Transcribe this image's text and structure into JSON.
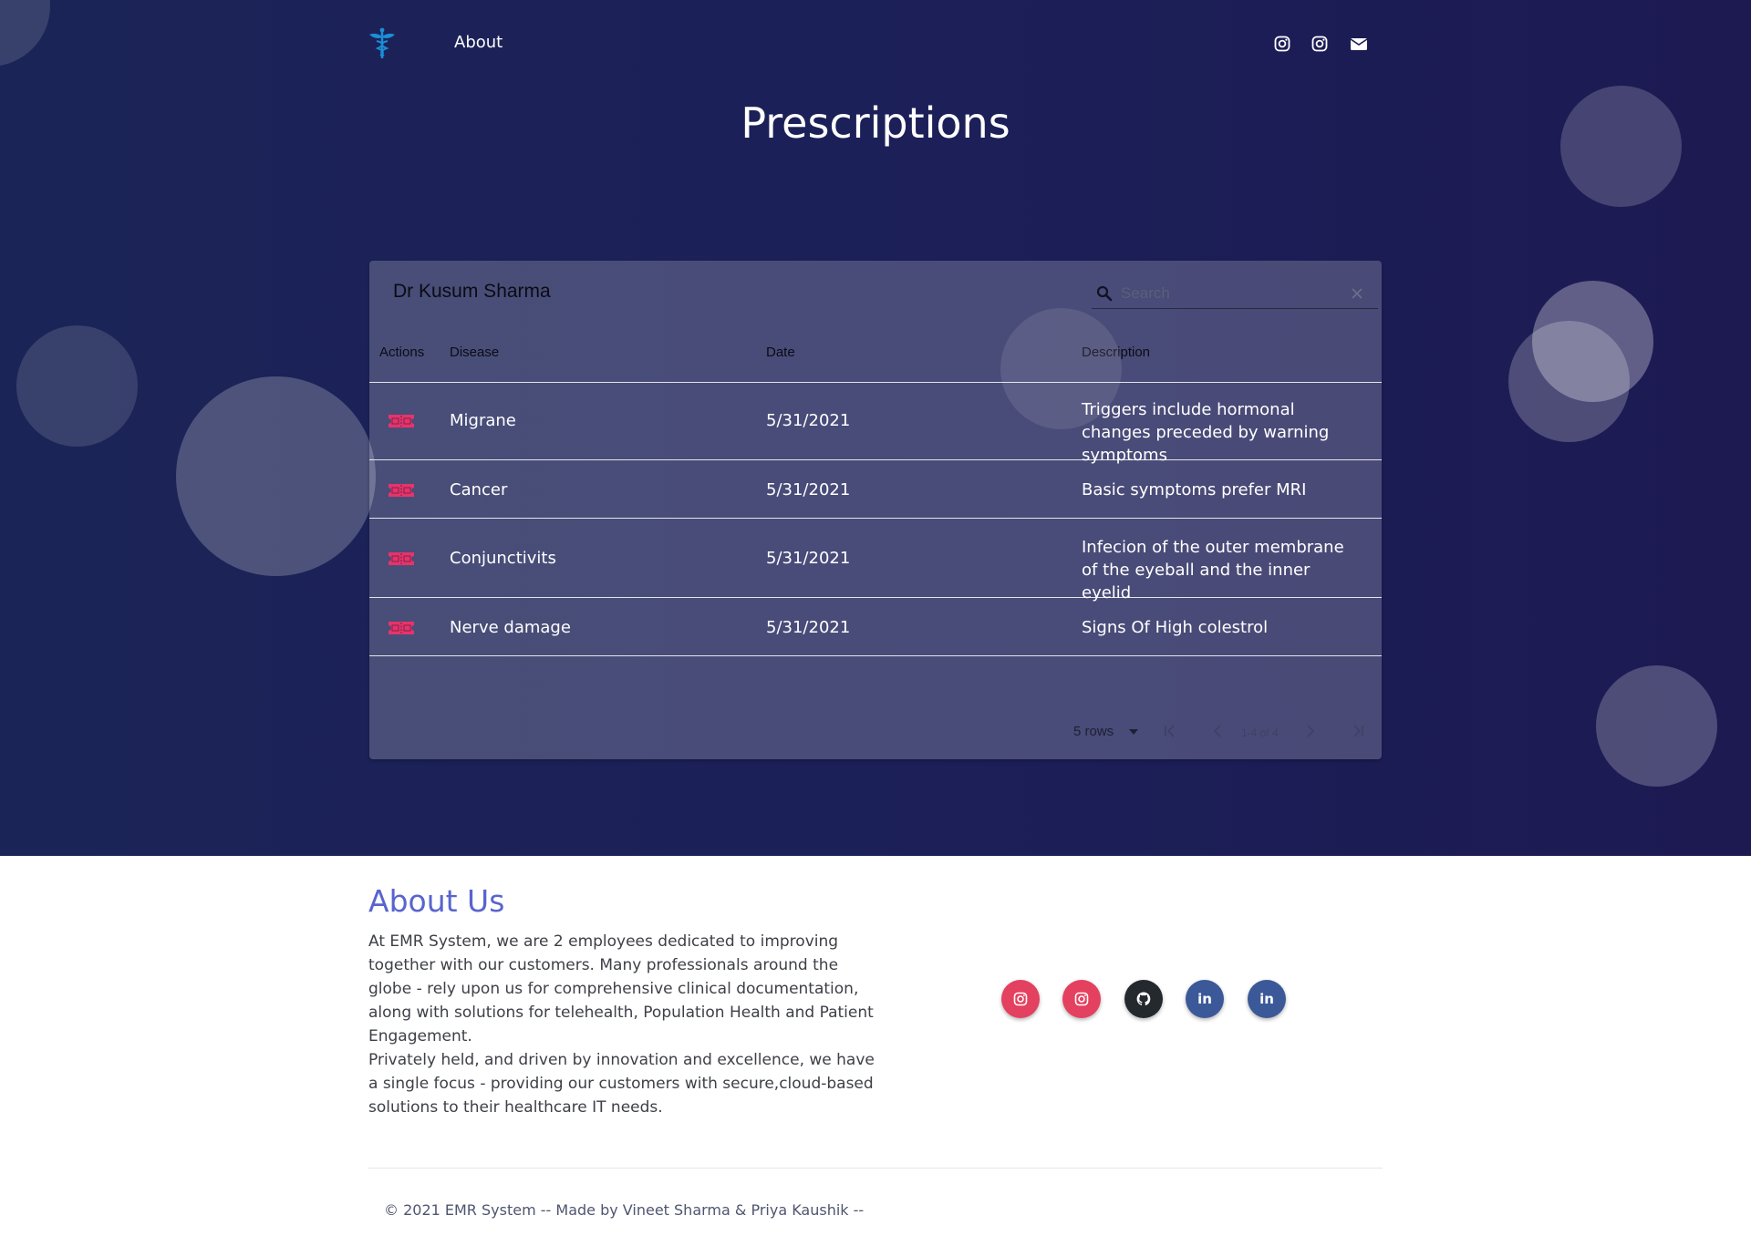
{
  "nav": {
    "about_label": "About"
  },
  "page": {
    "title": "Prescriptions"
  },
  "table": {
    "doctor_name": "Dr Kusum Sharma",
    "search_placeholder": "Search",
    "columns": [
      "Actions",
      "Disease",
      "Date",
      "Description"
    ],
    "rows": [
      {
        "disease": "Migrane",
        "date": "5/31/2021",
        "description": "Triggers include hormonal changes preceded by warning symptoms"
      },
      {
        "disease": "Cancer",
        "date": "5/31/2021",
        "description": "Basic symptoms prefer MRI"
      },
      {
        "disease": "Conjunctivits",
        "date": "5/31/2021",
        "description": "Infecion of the outer membrane of the eyeball and the inner eyelid"
      },
      {
        "disease": "Nerve damage",
        "date": "5/31/2021",
        "description": "Signs Of High colestrol"
      }
    ],
    "action_icon": "ticket-icon",
    "action_color": "#e7336b",
    "pagination": {
      "rows_label": "5 rows",
      "range_label": "1-4 of 4"
    }
  },
  "about": {
    "title": "About Us",
    "paragraph1": "At EMR System, we are 2 employees dedicated to improving together with our customers. Many professionals around the globe - rely upon us for comprehensive clinical documentation, along with solutions for telehealth, Population Health and Patient Engagement.",
    "paragraph2": "Privately held, and driven by innovation and excellence, we have a single focus - providing our customers with secure,cloud-based solutions to their healthcare IT needs."
  },
  "social": [
    {
      "icon": "instagram-icon",
      "color": "#e4405f"
    },
    {
      "icon": "instagram-icon",
      "color": "#e4405f"
    },
    {
      "icon": "github-icon",
      "color": "#24292e"
    },
    {
      "icon": "linkedin-icon",
      "color": "#3b5998",
      "label": "in"
    },
    {
      "icon": "linkedin-icon",
      "color": "#3b5998",
      "label": "in"
    }
  ],
  "footer": {
    "copyright": "© 2021 EMR System -- Made by Vineet Sharma & Priya Kaushik --"
  },
  "colors": {
    "hero_bg": "#1c1f58",
    "accent": "#5865ce",
    "action_pink": "#e7336b"
  }
}
